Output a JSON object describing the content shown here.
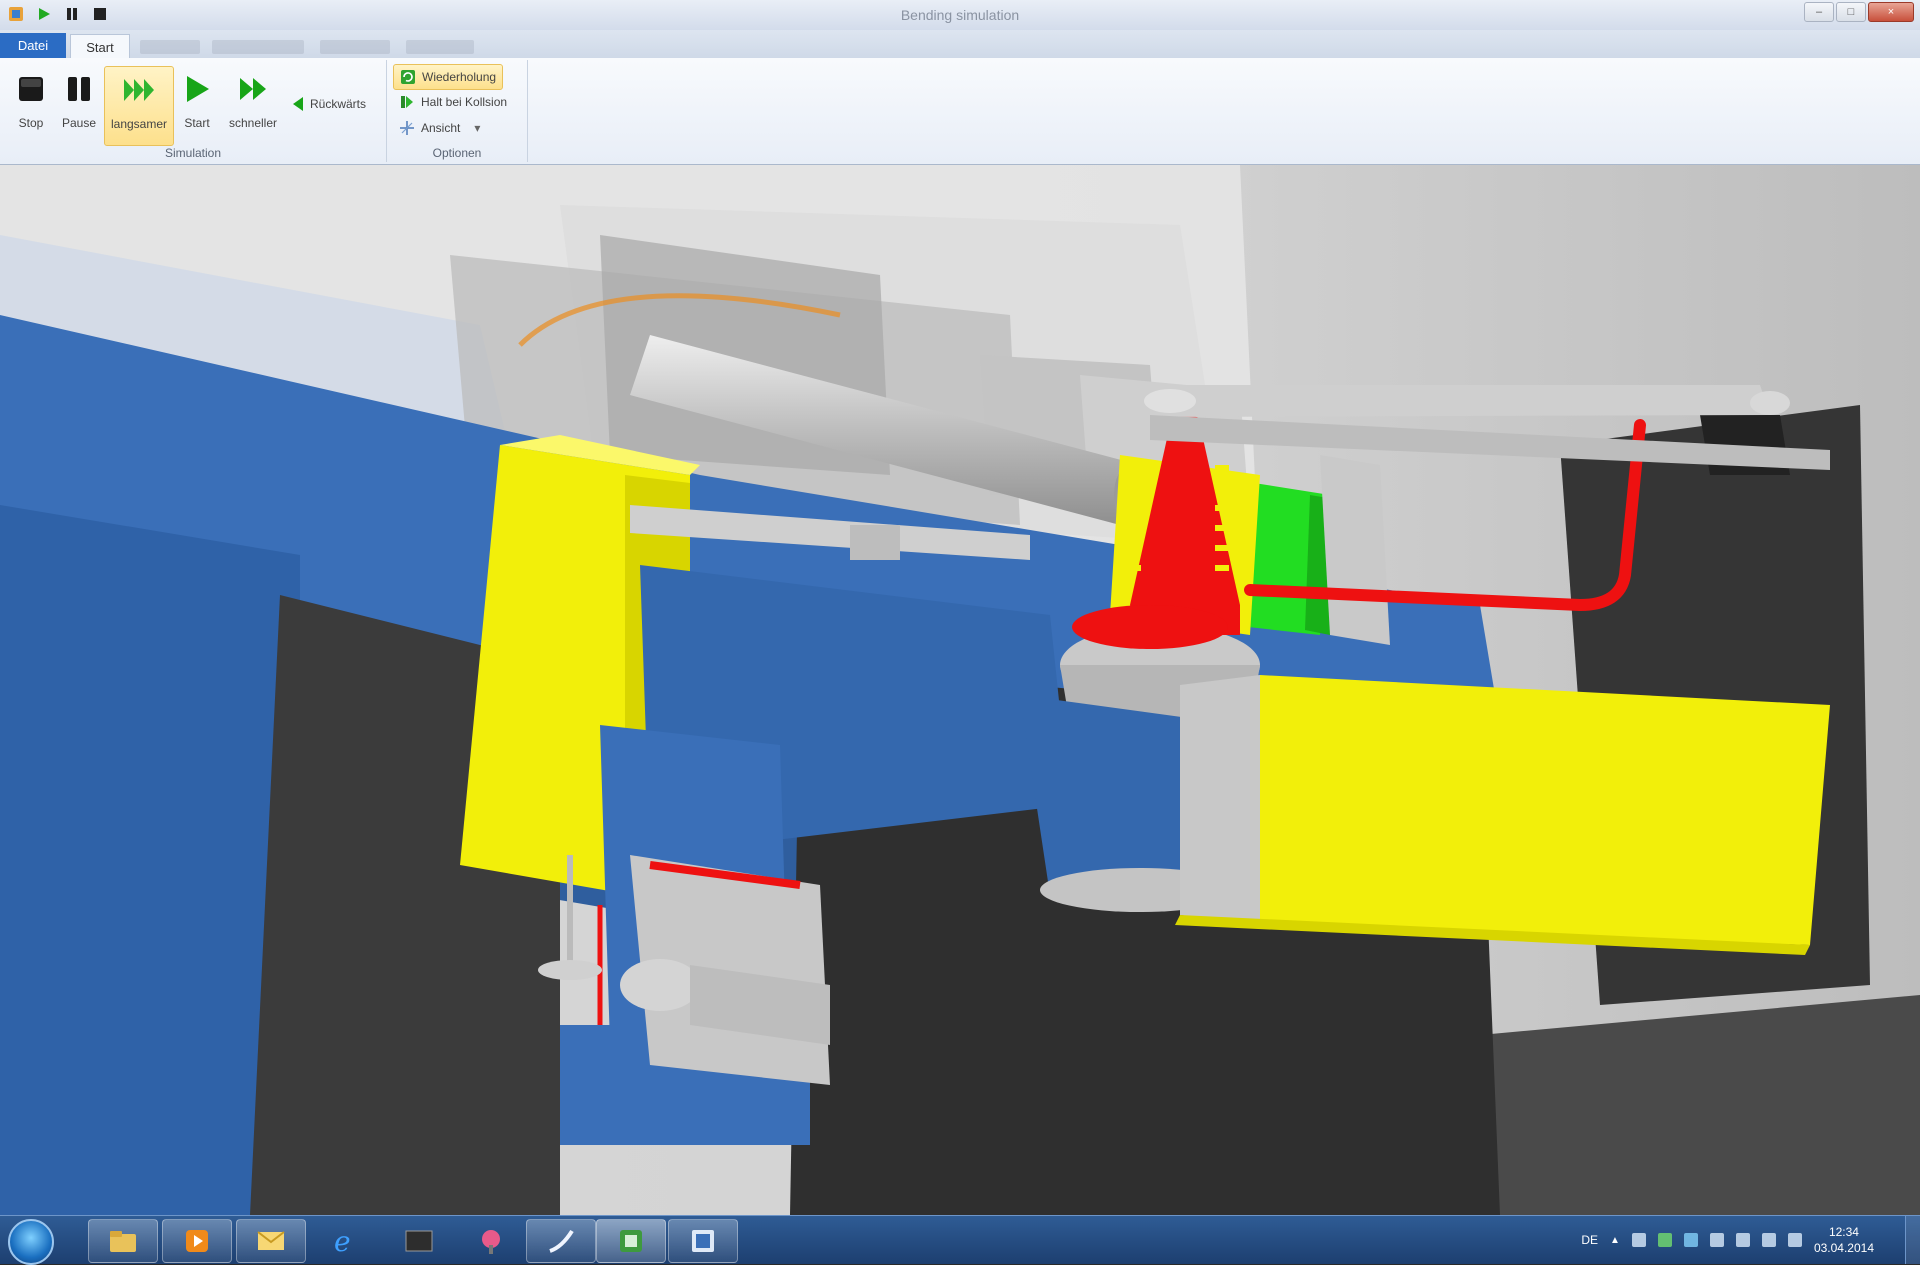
{
  "window": {
    "title": "Bending simulation",
    "controls": {
      "minimize": "–",
      "maximize": "□",
      "close": "×"
    }
  },
  "quick_access": [
    "app-icon",
    "play-icon",
    "pause-icon",
    "stop-icon"
  ],
  "tabs": [
    {
      "label": "Datei",
      "active": false
    },
    {
      "label": "Start",
      "active": true
    }
  ],
  "ribbon": {
    "simulation_group": {
      "label": "Simulation",
      "buttons": [
        {
          "label": "Stop",
          "icon": "stop-icon"
        },
        {
          "label": "Pause",
          "icon": "pause-icon"
        },
        {
          "label": "langsamer",
          "icon": "slower-icon",
          "active": true
        },
        {
          "label": "Start",
          "icon": "play-icon"
        },
        {
          "label": "schneller",
          "icon": "faster-icon"
        },
        {
          "label": "Rückwärts",
          "icon": "backward-icon"
        }
      ]
    },
    "options_group": {
      "label": "Optionen",
      "items": [
        {
          "label": "Wiederholung",
          "icon": "repeat-icon",
          "active": true
        },
        {
          "label": "Halt bei Kollsion",
          "icon": "halt-icon"
        },
        {
          "label": "Ansicht",
          "icon": "view-icon",
          "dropdown": "▾"
        }
      ]
    }
  },
  "colors": {
    "machine_blue": "#3a6fb8",
    "clamp_yellow": "#f2ef0a",
    "tube_red": "#ee1111",
    "collision_green": "#22dd22",
    "frame_dark": "#3a3a3a",
    "tool_gray": "#b9b9b9"
  },
  "taskbar": {
    "apps": [
      "explorer-icon",
      "media-player-icon",
      "outlook-icon",
      "internet-explorer-icon",
      "terminal-icon",
      "paint-icon",
      "app-swoosh-icon",
      "bending-app-icon",
      "editor-icon"
    ],
    "language": "DE",
    "time": "12:34",
    "date": "03.04.2014"
  }
}
